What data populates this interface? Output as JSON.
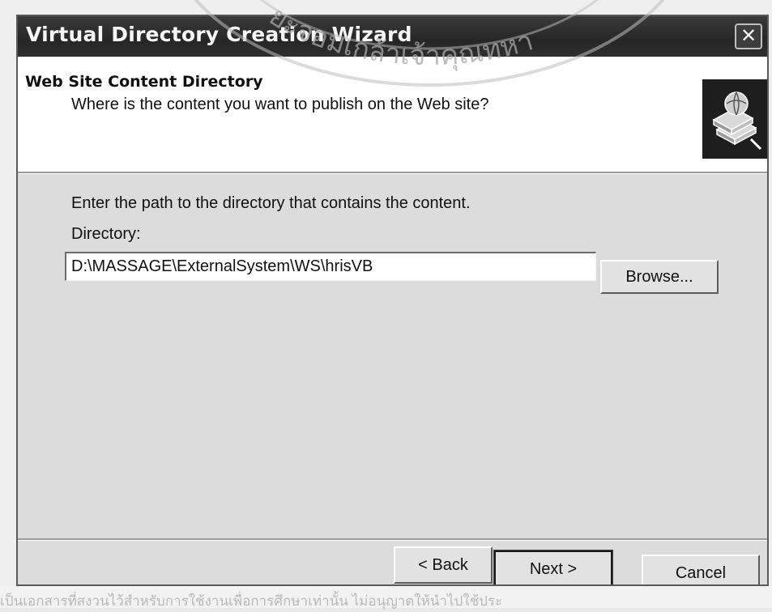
{
  "window": {
    "title": "Virtual Directory Creation Wizard",
    "close_symbol": "✕"
  },
  "header": {
    "title": "Web Site Content Directory",
    "subtitle": "Where is the content you want to publish on the Web site?",
    "icon": "books-globe-icon"
  },
  "content": {
    "instruction": "Enter the path to the directory that contains the content.",
    "directory_label": "Directory:",
    "directory_value": "D:\\MASSAGE\\ExternalSystem\\WS\\hrisVB",
    "browse_label": "Browse..."
  },
  "footer": {
    "back_label": "< Back",
    "next_label": "Next >",
    "cancel_label": "Cancel"
  },
  "watermark": {
    "seal_text": "ยะจอมเกล้าเจ้าคุณทหา",
    "bottom_text": "เป็นเอกสารที่สงวนไว้สำหรับการใช้งานเพื่อการศึกษาเท่านั้น ไม่อนุญาตให้นำไปใช้ประ"
  }
}
